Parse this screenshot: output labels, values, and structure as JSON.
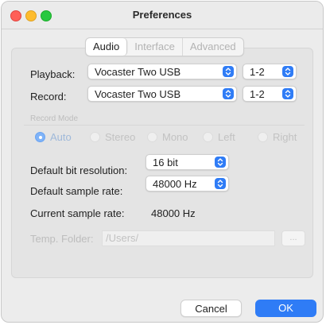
{
  "window": {
    "title": "Preferences"
  },
  "tabs": [
    {
      "label": "Audio",
      "active": true
    },
    {
      "label": "Interface",
      "active": false
    },
    {
      "label": "Advanced",
      "active": false
    }
  ],
  "playback": {
    "label": "Playback:",
    "device": "Vocaster Two USB",
    "channels": "1-2"
  },
  "record": {
    "label": "Record:",
    "device": "Vocaster Two USB",
    "channels": "1-2"
  },
  "record_mode": {
    "label": "Record Mode",
    "enabled": false,
    "options": [
      "Auto",
      "Stereo",
      "Mono",
      "Left",
      "Right"
    ],
    "selected": "Auto"
  },
  "bit_resolution": {
    "label": "Default bit resolution:",
    "value": "16 bit"
  },
  "sample_rate": {
    "label": "Default sample rate:",
    "value": "48000 Hz"
  },
  "current_rate": {
    "label": "Current sample rate:",
    "value": "48000 Hz"
  },
  "temp_folder": {
    "label": "Temp. Folder:",
    "value": "/Users/",
    "browse_label": "...",
    "enabled": false
  },
  "buttons": {
    "cancel": "Cancel",
    "ok": "OK"
  },
  "colors": {
    "accent": "#2f7cf6",
    "close": "#ff5f57",
    "minimize": "#febc2e",
    "maximize": "#28c840"
  }
}
